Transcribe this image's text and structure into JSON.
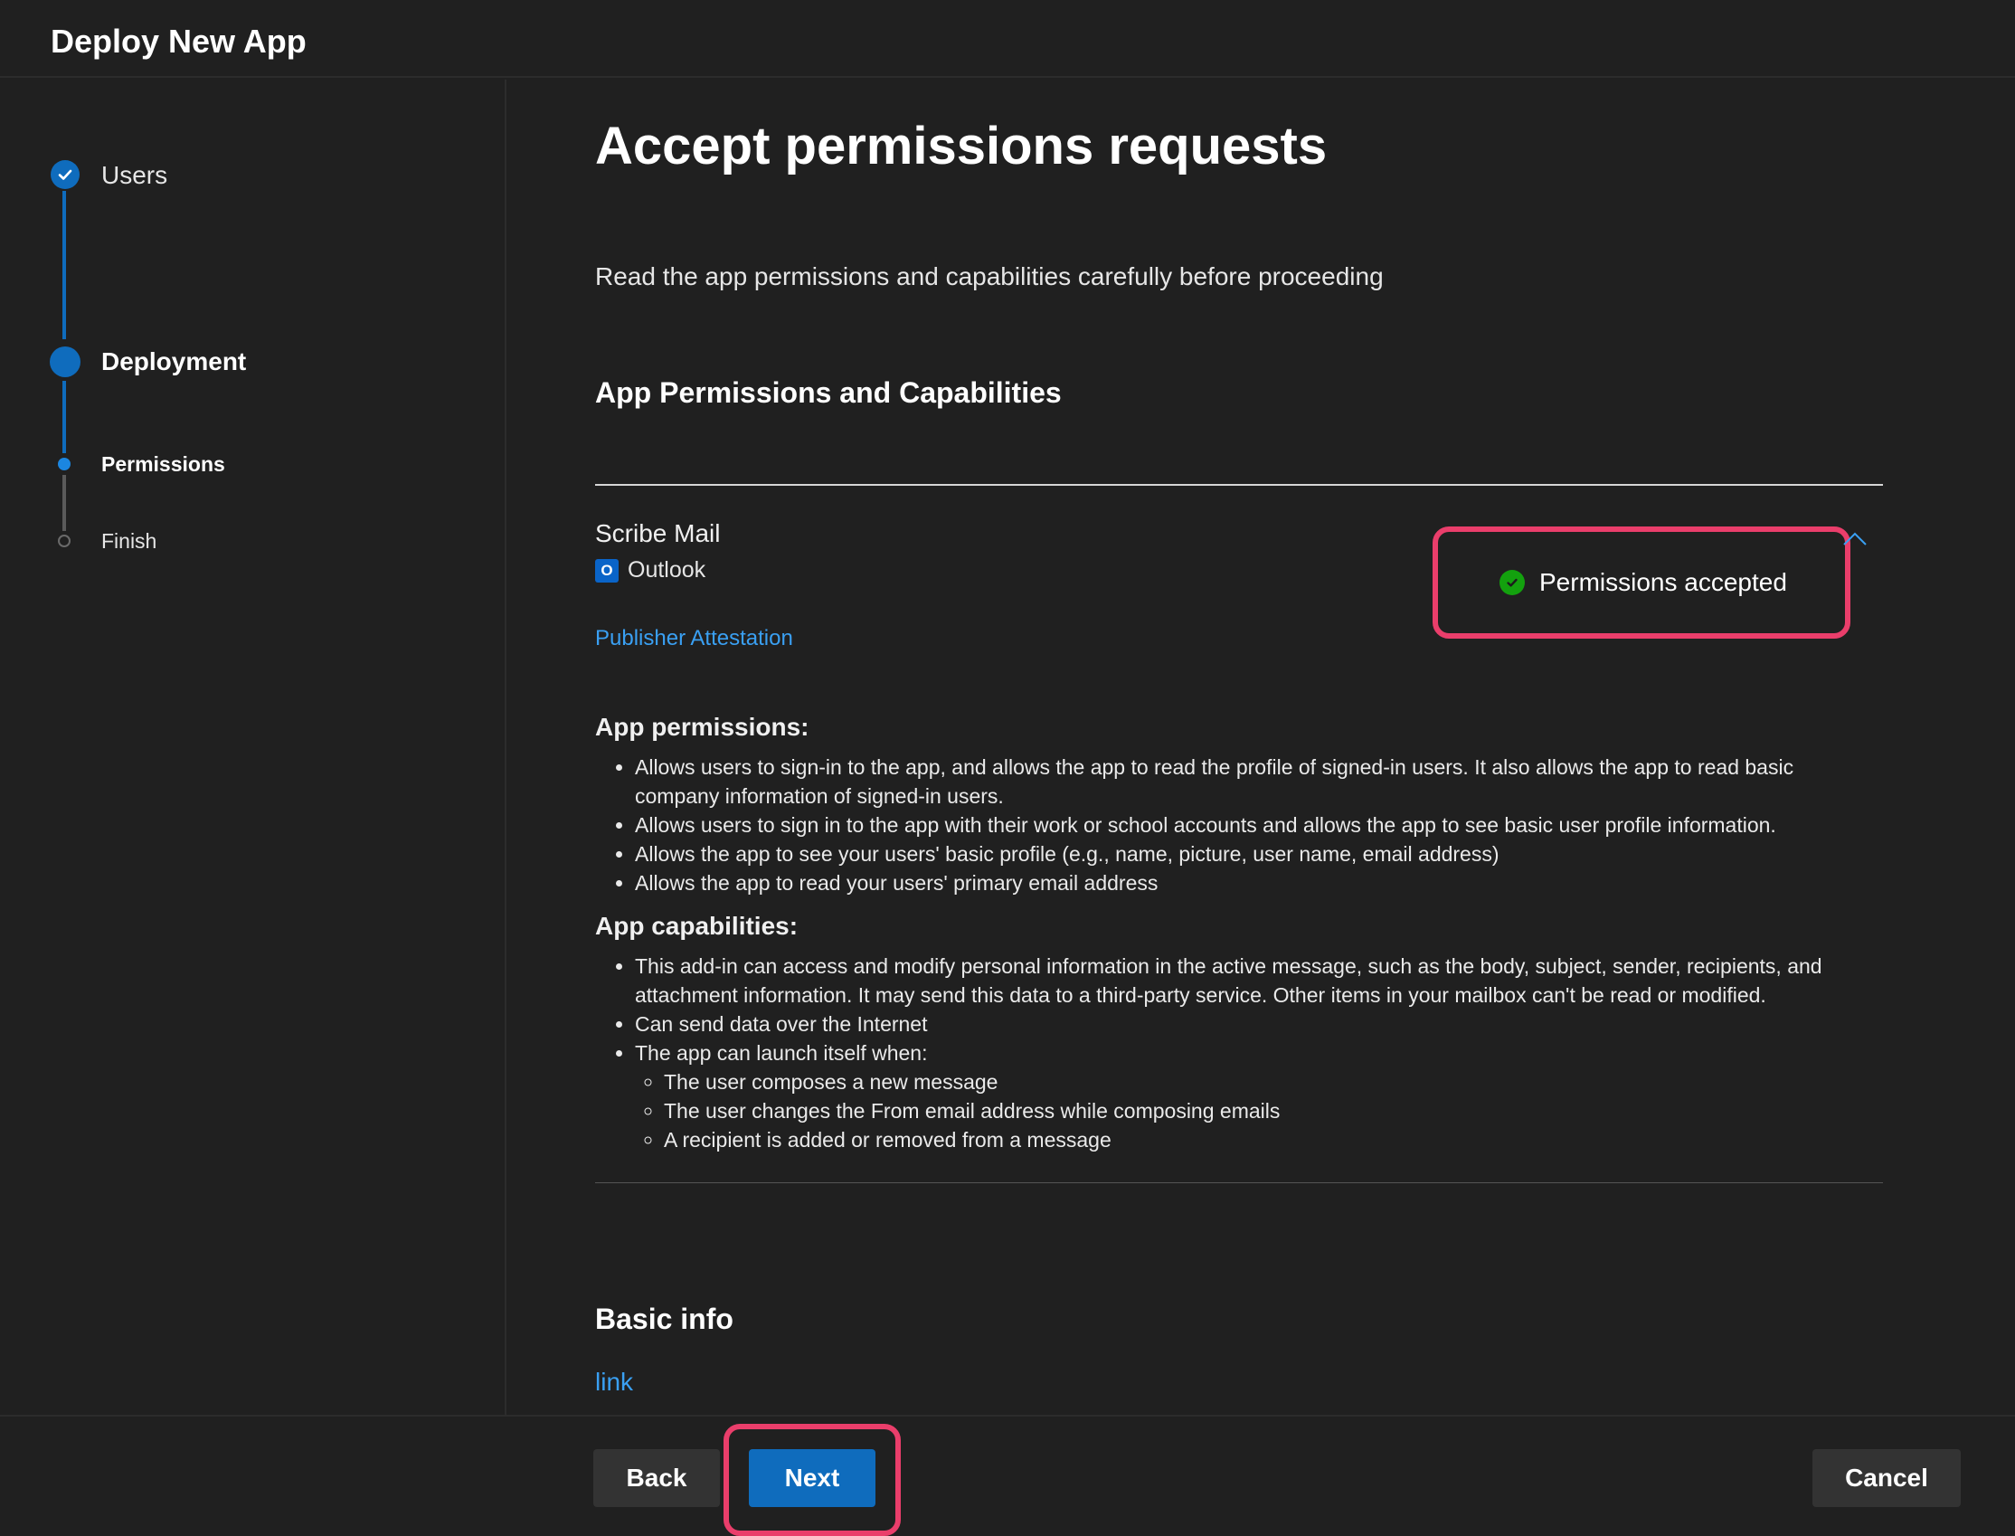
{
  "header": {
    "title": "Deploy New App"
  },
  "stepper": {
    "steps": [
      {
        "label": "Users",
        "state": "completed"
      },
      {
        "label": "Deployment",
        "state": "current"
      },
      {
        "label": "Permissions",
        "state": "current-substep"
      },
      {
        "label": "Finish",
        "state": "upcoming"
      }
    ]
  },
  "main": {
    "heading": "Accept permissions requests",
    "subtitle": "Read the app permissions and capabilities carefully before proceeding",
    "section_title": "App Permissions and Capabilities",
    "app": {
      "name": "Scribe Mail",
      "host": "Outlook",
      "host_icon_letter": "O",
      "publisher_link": "Publisher Attestation",
      "status": "Permissions accepted"
    },
    "permissions": {
      "title": "App permissions:",
      "items": [
        "Allows users to sign-in to the app, and allows the app to read the profile of signed-in users. It also allows the app to read basic company information of signed-in users.",
        "Allows users to sign in to the app with their work or school accounts and allows the app to see basic user profile information.",
        "Allows the app to see your users' basic profile (e.g., name, picture, user name, email address)",
        "Allows the app to read your users' primary email address"
      ]
    },
    "capabilities": {
      "title": "App capabilities:",
      "items": [
        "This add-in can access and modify personal information in the active message, such as the body, subject, sender, recipients, and attachment information. It may send this data to a third-party service. Other items in your mailbox can't be read or modified.",
        "Can send data over the Internet",
        "The app can launch itself when:"
      ],
      "launch_conditions": [
        "The user composes a new message",
        "The user changes the From email address while composing emails",
        "A recipient is added or removed from a message"
      ]
    },
    "basic_info": {
      "title": "Basic info",
      "link": "link"
    }
  },
  "footer": {
    "back_label": "Back",
    "next_label": "Next",
    "cancel_label": "Cancel"
  },
  "colors": {
    "accent": "#0f6cbd",
    "link": "#3aa0f3",
    "success": "#13a10e",
    "highlight": "#ea3e6b",
    "background": "#202020"
  }
}
